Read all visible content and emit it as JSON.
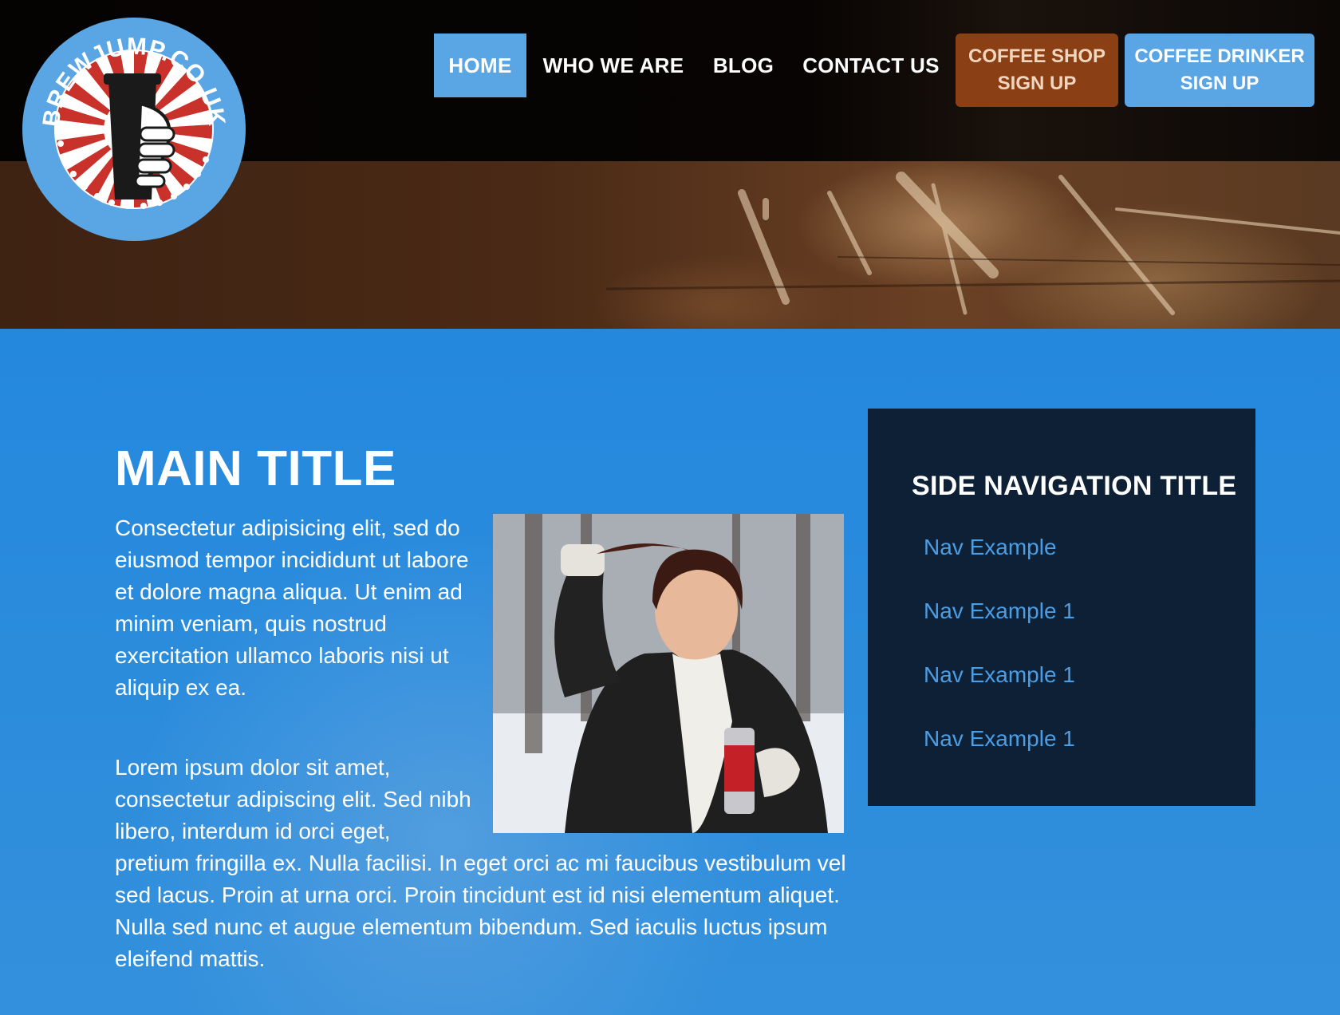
{
  "brand": {
    "logo_text": "BREWJUMP.CO.UK"
  },
  "nav": {
    "items": [
      {
        "label": "HOME",
        "active": true
      },
      {
        "label": "WHO WE ARE",
        "active": false
      },
      {
        "label": "BLOG",
        "active": false
      },
      {
        "label": "CONTACT US",
        "active": false
      }
    ],
    "cta_shop": {
      "line1": "COFFEE SHOP",
      "line2": "SIGN UP"
    },
    "cta_drinker": {
      "line1": "COFFEE DRINKER",
      "line2": "SIGN UP"
    }
  },
  "main": {
    "title": "MAIN TITLE",
    "paragraph1": "Consectetur adipisicing elit, sed do eiusmod tempor incididunt ut labore et dolore magna aliqua. Ut enim ad minim veniam, quis nostrud exercitation ullamco laboris nisi ut aliquip ex ea.",
    "paragraph2_start": "Lorem ipsum dolor sit amet, consectetur adipiscing elit. Sed nibh libero, interdum id orci eget,",
    "paragraph2_rest": "pretium fringilla ex. Nulla facilisi. In eget orci ac mi faucibus vestibulum vel sed lacus. Proin at urna orci. Proin tincidunt est id nisi elementum aliquet. Nulla sed nunc et augue elementum bibendum. Sed iaculis luctus ipsum eleifend mattis."
  },
  "sidebar": {
    "title": "SIDE NAVIGATION TITLE",
    "links": [
      "Nav Example",
      "Nav Example 1",
      "Nav Example 1",
      "Nav Example 1"
    ]
  },
  "colors": {
    "accent_blue": "#5aa6e4",
    "shop_brown": "#8a3f15",
    "sidebar_bg": "#0d2035",
    "link_blue": "#4a9ee6",
    "main_bg": "#2a8ad9"
  }
}
